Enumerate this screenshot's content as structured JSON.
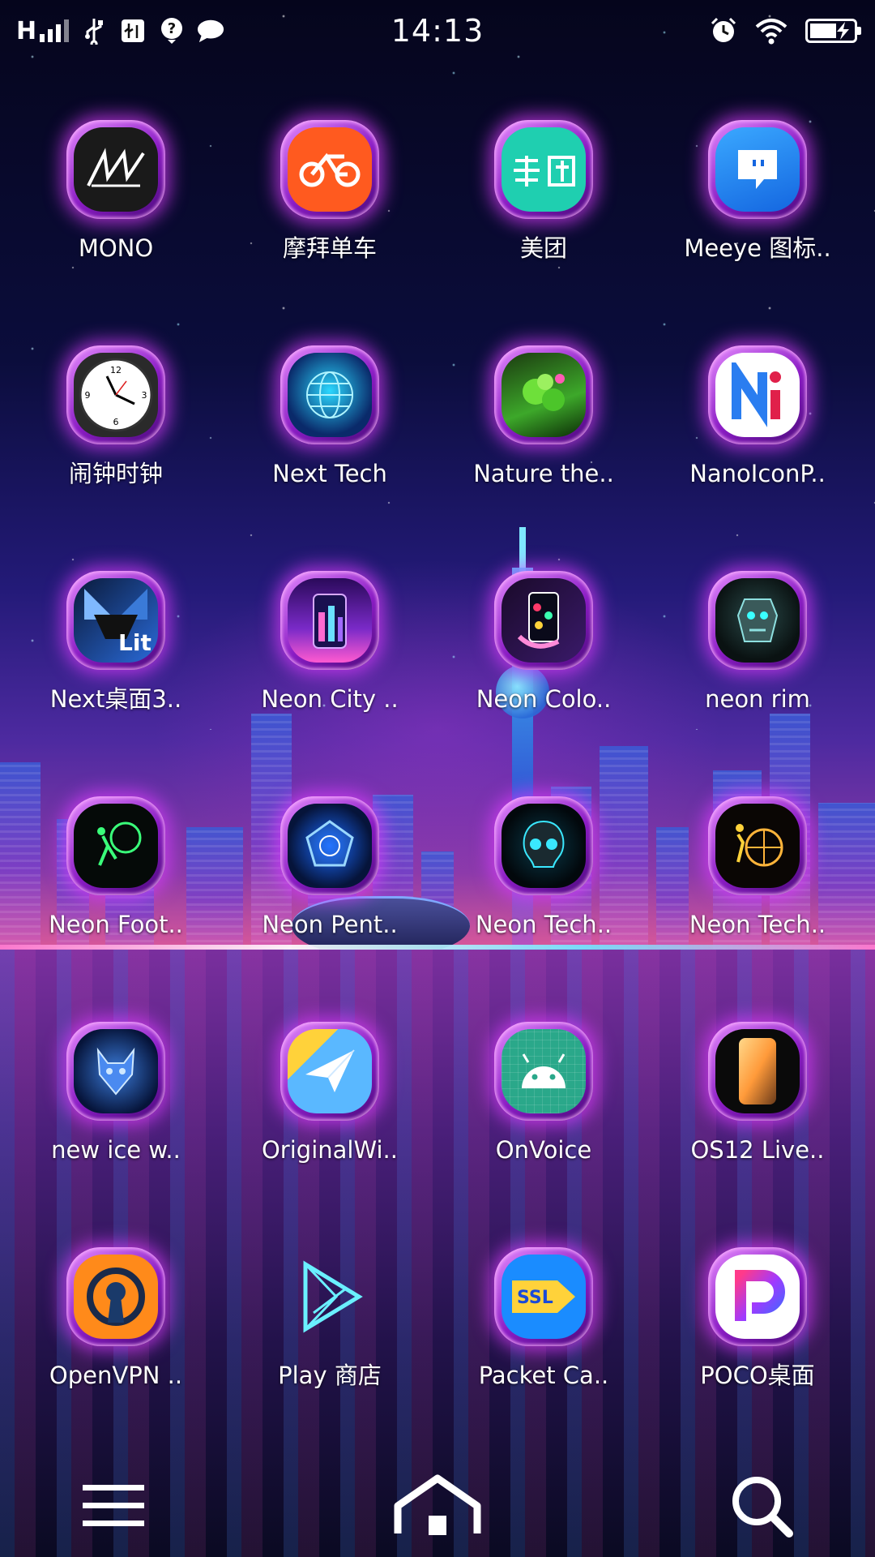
{
  "status_bar": {
    "network_type": "H",
    "time": "14:13",
    "icons": [
      "signal-bars-icon",
      "usb-icon",
      "usb-debug-icon",
      "help-icon",
      "message-icon",
      "alarm-icon",
      "wifi-icon",
      "battery-charging-icon"
    ]
  },
  "apps": [
    [
      {
        "label": "MONO",
        "icon": "mono-icon"
      },
      {
        "label": "摩拜单车",
        "icon": "mobike-icon"
      },
      {
        "label": "美团",
        "icon": "meituan-icon"
      },
      {
        "label": "Meeye 图标..",
        "icon": "meeye-icon"
      }
    ],
    [
      {
        "label": "闹钟时钟",
        "icon": "alarm-clock-icon"
      },
      {
        "label": "Next Tech",
        "icon": "next-tech-icon"
      },
      {
        "label": "Nature the..",
        "icon": "nature-theme-icon"
      },
      {
        "label": "NanoIconP..",
        "icon": "nano-icon-pack-icon"
      }
    ],
    [
      {
        "label": "Next桌面3..",
        "icon": "next-launcher-icon"
      },
      {
        "label": "Neon City ..",
        "icon": "neon-city-icon"
      },
      {
        "label": "Neon Colo..",
        "icon": "neon-color-icon"
      },
      {
        "label": "neon rim",
        "icon": "neon-rim-icon"
      }
    ],
    [
      {
        "label": "Neon Foot..",
        "icon": "neon-football-icon"
      },
      {
        "label": "Neon Pent..",
        "icon": "neon-pentagon-icon"
      },
      {
        "label": "Neon Tech..",
        "icon": "neon-tech-skull-icon"
      },
      {
        "label": "Neon Tech..",
        "icon": "neon-tech-basketball-icon"
      }
    ],
    [
      {
        "label": "new ice w..",
        "icon": "new-ice-wolf-icon"
      },
      {
        "label": "OriginalWi..",
        "icon": "original-widget-icon"
      },
      {
        "label": "OnVoice",
        "icon": "android-icon"
      },
      {
        "label": "OS12 Live..",
        "icon": "os12-live-icon"
      }
    ],
    [
      {
        "label": "OpenVPN ..",
        "icon": "openvpn-icon"
      },
      {
        "label": "Play 商店",
        "icon": "play-store-icon"
      },
      {
        "label": "Packet Ca..",
        "icon": "packet-capture-icon"
      },
      {
        "label": "POCO桌面",
        "icon": "poco-launcher-icon"
      }
    ]
  ],
  "nav_bar": {
    "buttons": [
      "menu-icon",
      "home-icon",
      "search-icon"
    ]
  },
  "colors": {
    "neon_frame": "#c02cf0",
    "mobike_orange": "#ff5a1f",
    "meituan_teal": "#1fcfb0",
    "meeye_blue": "#1a8cff"
  }
}
